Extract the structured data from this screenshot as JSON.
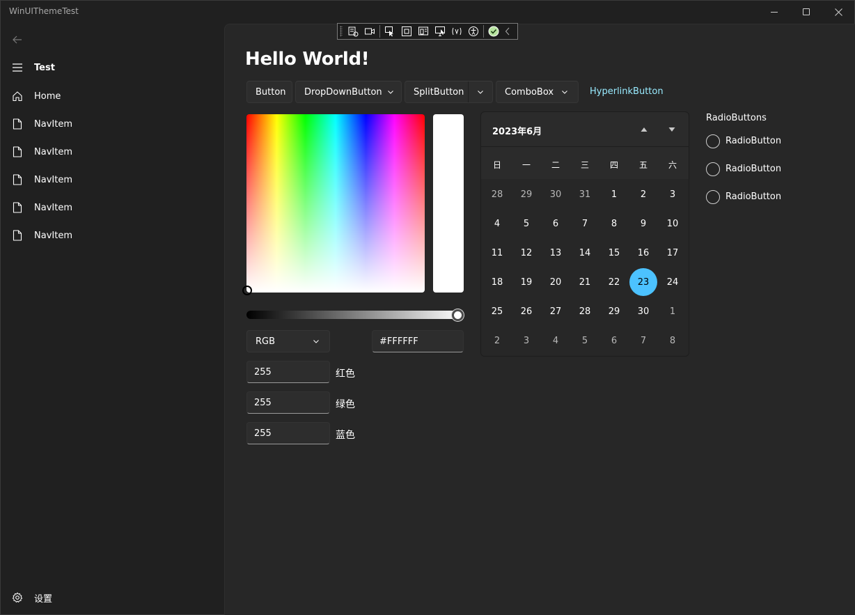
{
  "window": {
    "title": "WinUIThemeTest"
  },
  "nav": {
    "header": "Test",
    "items": [
      {
        "label": "Home",
        "icon": "home-icon"
      },
      {
        "label": "NavItem",
        "icon": "document-icon"
      },
      {
        "label": "NavItem",
        "icon": "document-icon"
      },
      {
        "label": "NavItem",
        "icon": "document-icon"
      },
      {
        "label": "NavItem",
        "icon": "document-icon"
      },
      {
        "label": "NavItem",
        "icon": "document-icon"
      }
    ],
    "settings_label": "设置"
  },
  "page": {
    "title": "Hello World!"
  },
  "buttons": {
    "button": "Button",
    "dropdown": "DropDownButton",
    "split": "SplitButton",
    "combo": "ComboBox",
    "hyperlink": "HyperlinkButton"
  },
  "color_picker": {
    "mode": "RGB",
    "hex": "#FFFFFF",
    "value_level": 1.0,
    "channels": [
      {
        "value": "255",
        "label": "红色"
      },
      {
        "value": "255",
        "label": "绿色"
      },
      {
        "value": "255",
        "label": "蓝色"
      }
    ],
    "preview_color": "#FFFFFF"
  },
  "calendar": {
    "month_label": "2023年6月",
    "days_of_week": [
      "日",
      "一",
      "二",
      "三",
      "四",
      "五",
      "六"
    ],
    "weeks": [
      [
        "28",
        "29",
        "30",
        "31",
        "1",
        "2",
        "3"
      ],
      [
        "4",
        "5",
        "6",
        "7",
        "8",
        "9",
        "10"
      ],
      [
        "11",
        "12",
        "13",
        "14",
        "15",
        "16",
        "17"
      ],
      [
        "18",
        "19",
        "20",
        "21",
        "22",
        "23",
        "24"
      ],
      [
        "25",
        "26",
        "27",
        "28",
        "29",
        "30",
        "1"
      ],
      [
        "2",
        "3",
        "4",
        "5",
        "6",
        "7",
        "8"
      ]
    ],
    "today": "23",
    "accent": "#4CC2FF"
  },
  "radios": {
    "header": "RadioButtons",
    "items": [
      "RadioButton",
      "RadioButton",
      "RadioButton"
    ]
  }
}
